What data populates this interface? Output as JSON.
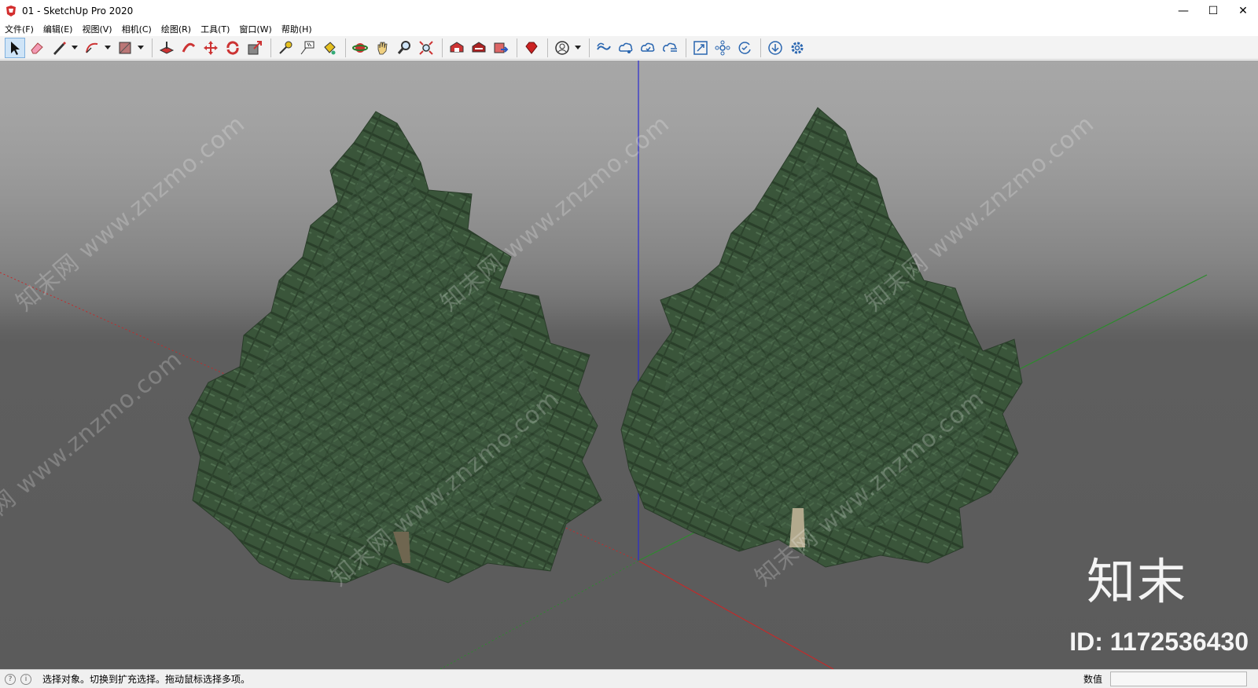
{
  "window": {
    "title": "01 - SketchUp Pro 2020"
  },
  "window_controls": {
    "minimize": "—",
    "maximize": "☐",
    "close": "✕"
  },
  "menu": [
    {
      "label": "文件(F)"
    },
    {
      "label": "编辑(E)"
    },
    {
      "label": "视图(V)"
    },
    {
      "label": "相机(C)"
    },
    {
      "label": "绘图(R)"
    },
    {
      "label": "工具(T)"
    },
    {
      "label": "窗口(W)"
    },
    {
      "label": "帮助(H)"
    }
  ],
  "toolbar": {
    "tools": [
      "select",
      "eraser",
      "line",
      "arc",
      "rectangle",
      "push-pull",
      "follow-me",
      "move",
      "rotate",
      "scale",
      "tape-measure",
      "text",
      "paint-bucket",
      "orbit",
      "pan",
      "zoom",
      "zoom-extents",
      "3d-warehouse",
      "extension-warehouse",
      "send-to-layout",
      "extension-manager",
      "profile",
      "trimble-connect",
      "trimble-connect-share",
      "trimble-connect-sync",
      "trimble-connect-list",
      "scan-essentials",
      "scan-settings",
      "scan-refresh",
      "download",
      "settings"
    ]
  },
  "viewport": {
    "watermark_text": "知末网 www.znzmo.com",
    "brand": "知末",
    "id_label": "ID: 1172536430",
    "colors": {
      "red_axis": "#c22b2b",
      "green_axis": "#2e8a2e",
      "blue_axis": "#2a2ad0",
      "foliage": "#3c5a3c"
    }
  },
  "status": {
    "hint": "选择对象。切换到扩充选择。拖动鼠标选择多项。",
    "measure_label": "数值",
    "measure_value": ""
  }
}
